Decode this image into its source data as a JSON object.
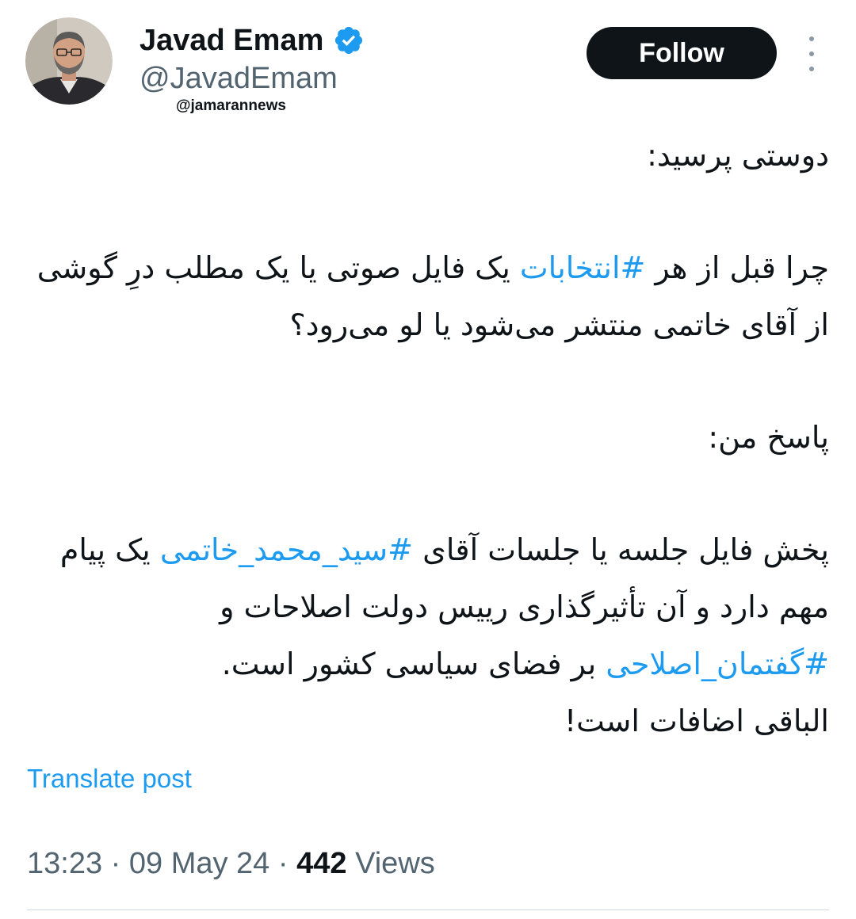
{
  "author": {
    "display_name": "Javad Emam",
    "handle": "@JavadEmam",
    "verified_icon": "verified-badge-icon",
    "avatar": "profile-photo"
  },
  "watermark": "@jamarannews",
  "actions": {
    "follow_label": "Follow",
    "more_icon": "more-vertical-icon"
  },
  "tweet": {
    "direction": "rtl",
    "paragraphs": [
      {
        "id": "p1",
        "segments": [
          {
            "text": "دوستی پرسید:",
            "hashtag": false
          }
        ]
      },
      {
        "id": "p2",
        "segments": [
          {
            "text": "چرا قبل از هر ",
            "hashtag": false
          },
          {
            "text": "#انتخابات",
            "hashtag": true
          },
          {
            "text": " یک فایل صوتی یا یک مطلب درِ گوشی از آقای خاتمی منتشر می‌شود یا لو می‌رود؟",
            "hashtag": false
          }
        ]
      },
      {
        "id": "p3",
        "segments": [
          {
            "text": "پاسخ من:",
            "hashtag": false
          }
        ]
      },
      {
        "id": "p4",
        "segments": [
          {
            "text": "پخش فایل جلسه یا جلسات آقای ",
            "hashtag": false
          },
          {
            "text": "#سید_محمد_خاتمی",
            "hashtag": true
          },
          {
            "text": " یک پیام مهم دارد و آن تأثیرگذاری رییس دولت اصلاحات و ",
            "hashtag": false
          },
          {
            "text": "#گفتمان_اصلاحی",
            "hashtag": true
          },
          {
            "text": " بر فضای سیاسی کشور است.",
            "hashtag": false
          }
        ]
      },
      {
        "id": "p5",
        "segments": [
          {
            "text": "الباقی اضافات است!",
            "hashtag": false
          }
        ]
      }
    ],
    "hashtag_color": "#1d9bf0"
  },
  "translate_label": "Translate post",
  "meta": {
    "time": "13:23",
    "separator": " · ",
    "date": "09 May 24",
    "views_count": "442",
    "views_label": "Views"
  },
  "colors": {
    "text": "#0f1419",
    "secondary": "#536471",
    "link": "#1d9bf0",
    "follow_bg": "#0f1419",
    "verified": "#1d9bf0"
  }
}
